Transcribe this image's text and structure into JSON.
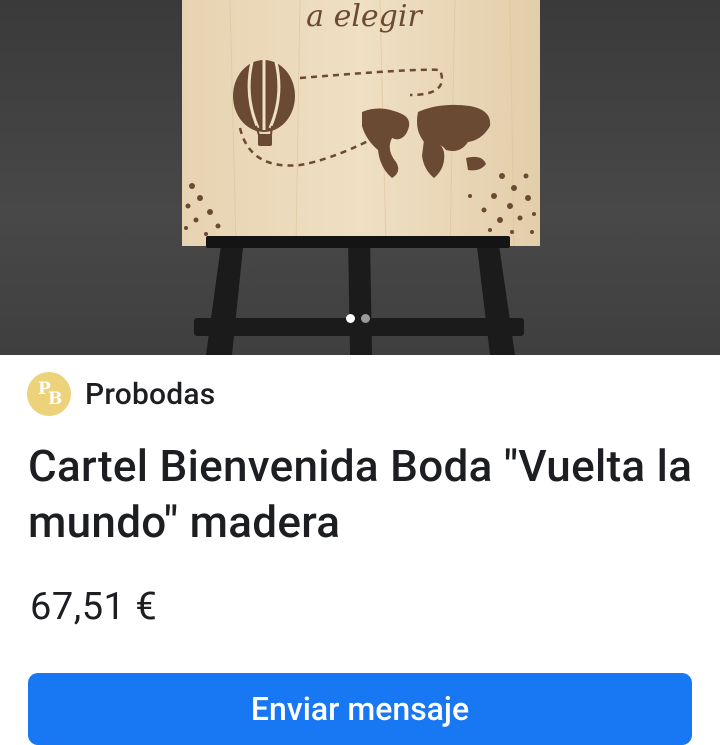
{
  "listing": {
    "image": {
      "sign_text": "a elegir",
      "carousel": {
        "total": 2,
        "current": 1
      }
    },
    "seller": {
      "logo_text_p": "P",
      "logo_text_b": "B",
      "name": "Probodas"
    },
    "title": "Cartel Bienvenida Boda \"Vuelta la mundo\" madera",
    "price": "67,51 €",
    "actions": {
      "send_message_label": "Enviar mensaje"
    }
  },
  "colors": {
    "accent": "#1877f2",
    "wood": "#e6d2b0",
    "print": "#6b4a34",
    "easel": "#1c1c1c",
    "logo": "#ecd27a"
  }
}
